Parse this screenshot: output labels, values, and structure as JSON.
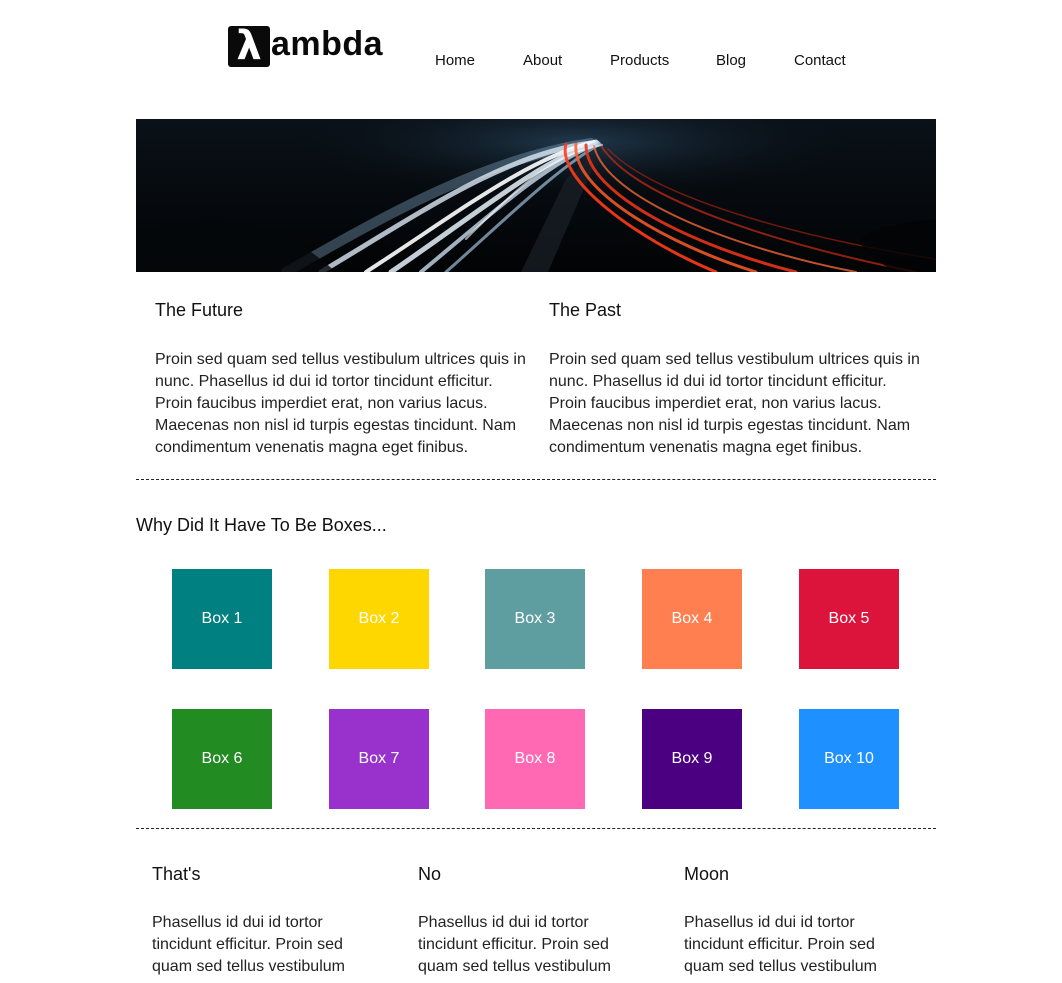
{
  "brand": {
    "mark": "λ",
    "word": "ambda"
  },
  "nav": [
    "Home",
    "About",
    "Products",
    "Blog",
    "Contact"
  ],
  "hero": {
    "alt": ""
  },
  "top_columns": [
    {
      "title": "The Future",
      "text": "Proin sed quam sed tellus vestibulum ultrices quis in nunc. Phasellus id dui id tortor tincidunt efficitur. Proin faucibus imperdiet erat, non varius lacus. Maecenas non nisl id turpis egestas tincidunt. Nam condimentum venenatis magna eget finibus."
    },
    {
      "title": "The Past",
      "text": "Proin sed quam sed tellus vestibulum ultrices quis in nunc. Phasellus id dui id tortor tincidunt efficitur. Proin faucibus imperdiet erat, non varius lacus. Maecenas non nisl id turpis egestas tincidunt. Nam condimentum venenatis magna eget finibus."
    }
  ],
  "boxes_section": {
    "title": "Why Did It Have To Be Boxes...",
    "boxes": [
      {
        "label": "Box 1",
        "color": "#008080"
      },
      {
        "label": "Box 2",
        "color": "#FFD700"
      },
      {
        "label": "Box 3",
        "color": "#5F9EA0"
      },
      {
        "label": "Box 4",
        "color": "#FF7F50"
      },
      {
        "label": "Box 5",
        "color": "#DC143C"
      },
      {
        "label": "Box 6",
        "color": "#228B22"
      },
      {
        "label": "Box 7",
        "color": "#9932CC"
      },
      {
        "label": "Box 8",
        "color": "#FF69B4"
      },
      {
        "label": "Box 9",
        "color": "#4B0082"
      },
      {
        "label": "Box 10",
        "color": "#1E90FF"
      }
    ]
  },
  "bottom_columns": [
    {
      "title": "That's",
      "text": "Phasellus id dui id tortor tincidunt efficitur. Proin sed quam sed tellus vestibulum"
    },
    {
      "title": "No",
      "text": "Phasellus id dui id tortor tincidunt efficitur. Proin sed quam sed tellus vestibulum"
    },
    {
      "title": "Moon",
      "text": "Phasellus id dui id tortor tincidunt efficitur. Proin sed quam sed tellus vestibulum"
    }
  ]
}
